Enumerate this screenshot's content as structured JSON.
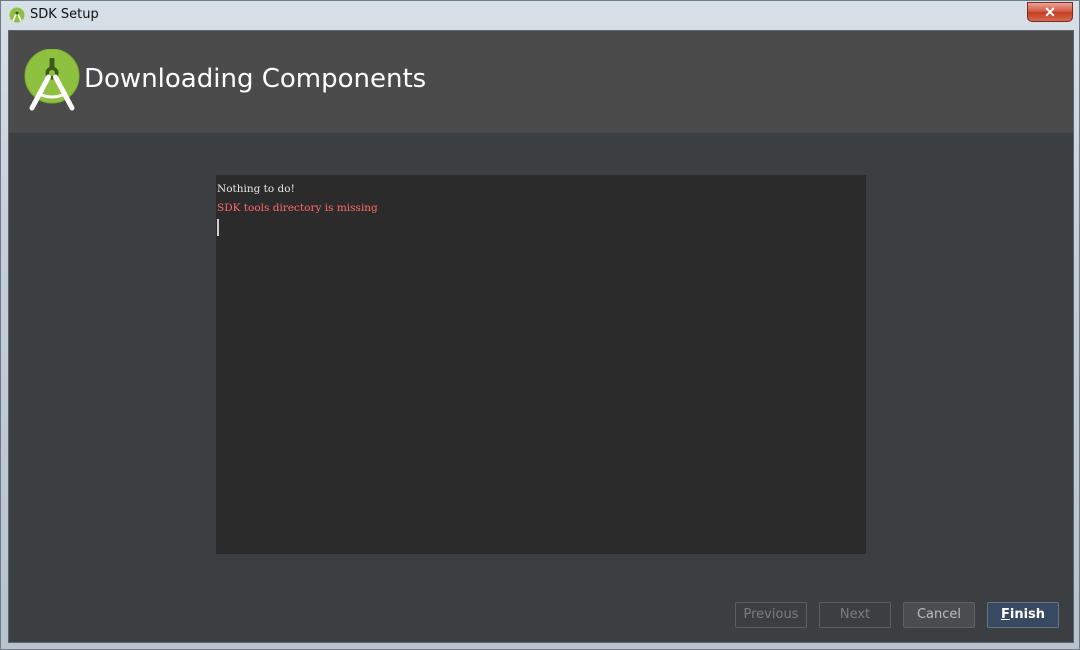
{
  "window": {
    "title": "SDK Setup",
    "close_label": "✕"
  },
  "header": {
    "title": "Downloading Components",
    "logo": "android-studio-icon"
  },
  "console": {
    "lines": [
      {
        "text": "Nothing to do!",
        "kind": "normal"
      },
      {
        "text": "SDK tools directory is missing",
        "kind": "error"
      }
    ]
  },
  "buttons": {
    "previous": "Previous",
    "next": "Next",
    "cancel": "Cancel",
    "finish": "Finish"
  },
  "colors": {
    "background": "#3c3f41",
    "header": "#4b4b4b",
    "console": "#2b2b2b",
    "error_text": "#ff6b68",
    "android_green": "#a4c639",
    "default_button": "#384a61"
  }
}
